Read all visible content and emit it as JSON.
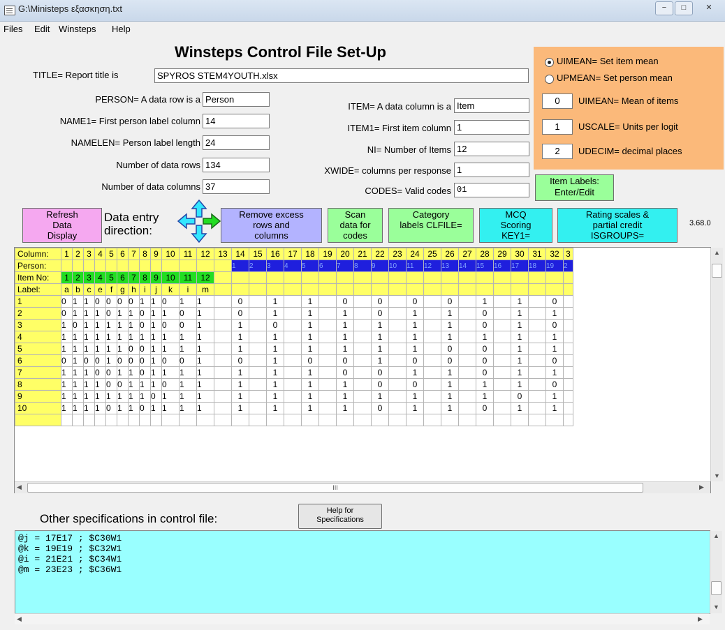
{
  "window": {
    "title": "G:\\Ministeps εξασκηση.txt",
    "controls": [
      "−",
      "□",
      "✕"
    ]
  },
  "menu": [
    "Files",
    "Edit",
    "Winsteps",
    "Help"
  ],
  "heading": "Winsteps Control File Set-Up",
  "title_field": {
    "label": "TITLE= Report title is",
    "value": "SPYROS STEM4YOUTH.xlsx"
  },
  "left_fields": [
    {
      "label": "PERSON= A data row is a",
      "value": "Person"
    },
    {
      "label": "NAME1= First person label column",
      "value": "14"
    },
    {
      "label": "NAMELEN= Person label length",
      "value": "24"
    },
    {
      "label": "Number of data rows",
      "value": "134"
    },
    {
      "label": "Number of data columns",
      "value": "37"
    }
  ],
  "right_fields": [
    {
      "label": "ITEM= A data column is a",
      "value": "Item"
    },
    {
      "label": "ITEM1= First item column",
      "value": "1"
    },
    {
      "label": "NI= Number of Items",
      "value": "12"
    },
    {
      "label": "XWIDE= columns per response",
      "value": "1"
    },
    {
      "label": "CODES= Valid codes",
      "value": "01"
    }
  ],
  "orange_panel": {
    "radios": [
      {
        "label": "UIMEAN= Set item mean",
        "selected": true
      },
      {
        "label": "UPMEAN= Set person mean",
        "selected": false
      }
    ],
    "settings": [
      {
        "value": "0",
        "label": "UIMEAN= Mean of items"
      },
      {
        "value": "1",
        "label": "USCALE= Units per logit"
      },
      {
        "value": "2",
        "label": "UDECIM= decimal places"
      }
    ],
    "item_labels_button": "Item Labels:\nEnter/Edit"
  },
  "toolbar": {
    "refresh": "Refresh\nData\nDisplay",
    "entry_direction": "Data entry\ndirection:",
    "remove_excess": "Remove excess\nrows and\ncolumns",
    "scan": "Scan\ndata for\ncodes",
    "category": "Category\nlabels CLFILE=",
    "mcq": "MCQ\nScoring\nKEY1=",
    "rating": "Rating scales &\npartial credit\nISGROUPS=",
    "version": "3.68.0"
  },
  "grid": {
    "row_headers": [
      "Column:",
      "Person:",
      "Item No:",
      "Label:"
    ],
    "columns": [
      "1",
      "2",
      "3",
      "4",
      "5",
      "6",
      "7",
      "8",
      "9",
      "10",
      "11",
      "12",
      "13",
      "14",
      "15",
      "16",
      "17",
      "18",
      "19",
      "20",
      "21",
      "22",
      "23",
      "24",
      "25",
      "26",
      "27",
      "28",
      "29",
      "30",
      "31",
      "32",
      "3"
    ],
    "person_numbers": [
      "1",
      "2",
      "3",
      "4",
      "5",
      "6",
      "7",
      "8",
      "9",
      "10",
      "11",
      "12",
      "13",
      "14",
      "15",
      "16",
      "17",
      "18",
      "19",
      "2"
    ],
    "item_numbers": [
      "1",
      "2",
      "3",
      "4",
      "5",
      "6",
      "7",
      "8",
      "9",
      "10",
      "11",
      "12"
    ],
    "labels": [
      "a",
      "b",
      "c",
      "e",
      "f",
      "g",
      "h",
      "i",
      "j",
      "k",
      "i",
      "m"
    ],
    "rows": [
      {
        "id": "1",
        "cells": [
          "0",
          "1",
          "1",
          "0",
          "0",
          "0",
          "0",
          "1",
          "1",
          "0",
          "1",
          "1",
          "",
          "0",
          "",
          "1",
          "",
          "1",
          "",
          "0",
          "",
          "0",
          "",
          "0",
          "",
          "0",
          "",
          "1",
          "",
          "1",
          "",
          "0",
          ""
        ]
      },
      {
        "id": "2",
        "cells": [
          "0",
          "1",
          "1",
          "1",
          "0",
          "1",
          "1",
          "0",
          "1",
          "1",
          "0",
          "1",
          "",
          "0",
          "",
          "1",
          "",
          "1",
          "",
          "1",
          "",
          "0",
          "",
          "1",
          "",
          "1",
          "",
          "0",
          "",
          "1",
          "",
          "1",
          ""
        ]
      },
      {
        "id": "3",
        "cells": [
          "1",
          "0",
          "1",
          "1",
          "1",
          "1",
          "1",
          "0",
          "1",
          "0",
          "0",
          "1",
          "",
          "1",
          "",
          "0",
          "",
          "1",
          "",
          "1",
          "",
          "1",
          "",
          "1",
          "",
          "1",
          "",
          "0",
          "",
          "1",
          "",
          "0",
          ""
        ]
      },
      {
        "id": "4",
        "cells": [
          "1",
          "1",
          "1",
          "1",
          "1",
          "1",
          "1",
          "1",
          "1",
          "1",
          "1",
          "1",
          "",
          "1",
          "",
          "1",
          "",
          "1",
          "",
          "1",
          "",
          "1",
          "",
          "1",
          "",
          "1",
          "",
          "1",
          "",
          "1",
          "",
          "1",
          ""
        ]
      },
      {
        "id": "5",
        "cells": [
          "1",
          "1",
          "1",
          "1",
          "1",
          "1",
          "0",
          "0",
          "1",
          "1",
          "1",
          "1",
          "",
          "1",
          "",
          "1",
          "",
          "1",
          "",
          "1",
          "",
          "1",
          "",
          "1",
          "",
          "0",
          "",
          "0",
          "",
          "1",
          "",
          "1",
          ""
        ]
      },
      {
        "id": "6",
        "cells": [
          "0",
          "1",
          "0",
          "0",
          "1",
          "0",
          "0",
          "0",
          "1",
          "0",
          "0",
          "1",
          "",
          "0",
          "",
          "1",
          "",
          "0",
          "",
          "0",
          "",
          "1",
          "",
          "0",
          "",
          "0",
          "",
          "0",
          "",
          "1",
          "",
          "0",
          ""
        ]
      },
      {
        "id": "7",
        "cells": [
          "1",
          "1",
          "1",
          "0",
          "0",
          "1",
          "1",
          "0",
          "1",
          "1",
          "1",
          "1",
          "",
          "1",
          "",
          "1",
          "",
          "1",
          "",
          "0",
          "",
          "0",
          "",
          "1",
          "",
          "1",
          "",
          "0",
          "",
          "1",
          "",
          "1",
          ""
        ]
      },
      {
        "id": "8",
        "cells": [
          "1",
          "1",
          "1",
          "1",
          "0",
          "0",
          "1",
          "1",
          "1",
          "0",
          "1",
          "1",
          "",
          "1",
          "",
          "1",
          "",
          "1",
          "",
          "1",
          "",
          "0",
          "",
          "0",
          "",
          "1",
          "",
          "1",
          "",
          "1",
          "",
          "0",
          ""
        ]
      },
      {
        "id": "9",
        "cells": [
          "1",
          "1",
          "1",
          "1",
          "1",
          "1",
          "1",
          "1",
          "0",
          "1",
          "1",
          "1",
          "",
          "1",
          "",
          "1",
          "",
          "1",
          "",
          "1",
          "",
          "1",
          "",
          "1",
          "",
          "1",
          "",
          "1",
          "",
          "0",
          "",
          "1",
          ""
        ]
      },
      {
        "id": "10",
        "cells": [
          "1",
          "1",
          "1",
          "1",
          "0",
          "1",
          "1",
          "0",
          "1",
          "1",
          "1",
          "1",
          "",
          "1",
          "",
          "1",
          "",
          "1",
          "",
          "1",
          "",
          "0",
          "",
          "1",
          "",
          "1",
          "",
          "0",
          "",
          "1",
          "",
          "1",
          ""
        ]
      }
    ]
  },
  "hscroll_mark": "III",
  "specs": {
    "label": "Other specifications in control file:",
    "help_button": "Help for\nSpecifications",
    "lines": "@j = 17E17 ; $C30W1\n@k = 19E19 ; $C32W1\n@i = 21E21 ; $C34W1\n@m = 23E23 ; $C36W1"
  },
  "colors": {
    "yellow": "#ffff66",
    "blue": "#1f1fdd",
    "green": "#22dd22",
    "orange": "#fbb97a",
    "spec_bg": "#99ffff"
  }
}
